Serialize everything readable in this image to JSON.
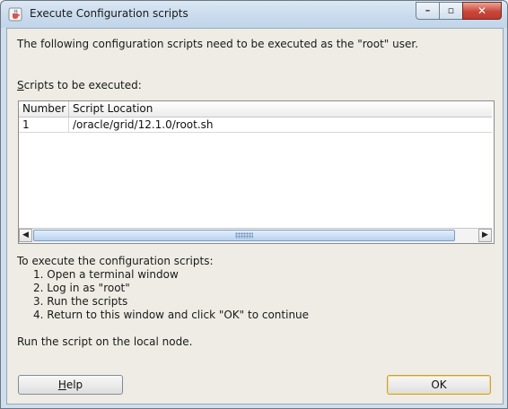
{
  "window": {
    "title": "Execute Configuration scripts",
    "app_icon": "java-cup-icon"
  },
  "caption_buttons": {
    "minimize": "–",
    "maximize": "▫",
    "close": "✕"
  },
  "intro_text": "The following configuration scripts need to be executed as the \"root\" user.",
  "scripts_label_mnemonic": "S",
  "scripts_label_rest": "cripts to be executed:",
  "table": {
    "columns": [
      "Number",
      "Script Location"
    ],
    "rows": [
      {
        "number": "1",
        "location": "/oracle/grid/12.1.0/root.sh"
      }
    ]
  },
  "scrollbar": {
    "left_arrow": "◀",
    "right_arrow": "▶"
  },
  "instructions": {
    "heading": "To execute the configuration scripts:",
    "steps": [
      "1. Open a terminal window",
      "2. Log in as \"root\"",
      "3. Run the scripts",
      "4. Return to this window and click \"OK\" to continue"
    ]
  },
  "local_node_text": "Run the script on the local node.",
  "buttons": {
    "help_mnemonic": "H",
    "help_rest": "elp",
    "ok": "OK"
  }
}
